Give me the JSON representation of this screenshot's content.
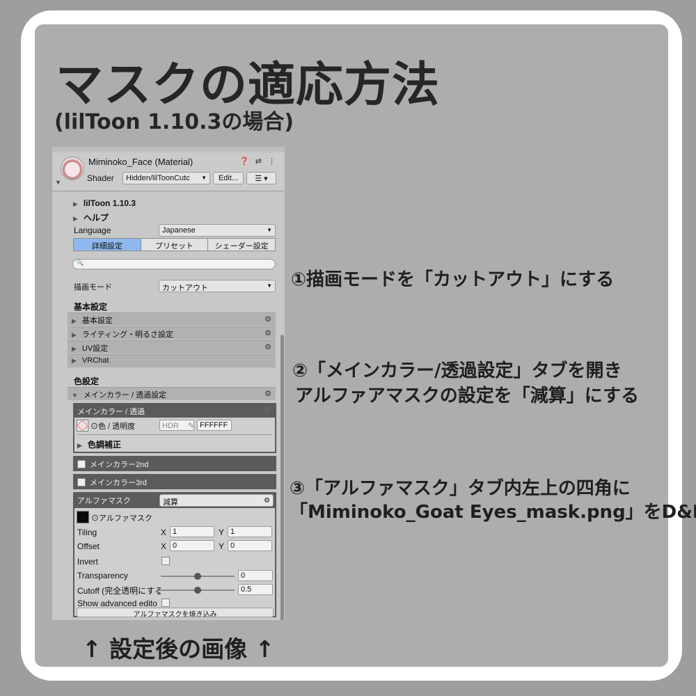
{
  "heading": {
    "title": "マスクの適応方法",
    "subtitle": "(lilToon 1.10.3の場合)"
  },
  "steps": [
    "①描画モードを「カットアウト」にする",
    "②「メインカラー/透過設定」タブを開き",
    "アルファアマスクの設定を「減算」にする",
    "③「アルファマスク」タブ内左上の四角に",
    "「Miminoko_Goat Eyes_mask.png」をD&D"
  ],
  "caption": "↑ 設定後の画像 ↑",
  "inspector": {
    "material_name": "Miminoko_Face (Material)",
    "header_icons": "❓ ⇄ ⋮",
    "shader_label": "Shader",
    "shader_value": "Hidden/lilToonCutc",
    "edit_button": "Edit...",
    "list_button": "☰ ▾",
    "version": "lilToon 1.10.3",
    "help": "ヘルプ",
    "language_label": "Language",
    "language_value": "Japanese",
    "tabs": [
      "詳細設定",
      "プリセット",
      "シェーダー設定"
    ],
    "search_icon": "🔍",
    "render_mode_label": "描画モード",
    "render_mode_value": "カットアウト",
    "basic_section": "基本設定",
    "basic_items": [
      "基本設定",
      "ライティング・明るさ設定",
      "UV設定",
      "VRChat"
    ],
    "color_section": "色設定",
    "main_color_header": "メインカラー / 透過設定",
    "main_color_box": {
      "title": "メインカラー / 透過",
      "color_label": "⊙色 / 透明度",
      "hdr": "HDR",
      "hex": "FFFFFF",
      "tone": "色調補正"
    },
    "main_color_2nd": "メインカラー2nd",
    "main_color_3rd": "メインカラー3rd",
    "alpha_mask": {
      "title": "アルファマスク",
      "mode": "減算",
      "texture_label": "⊙アルファマスク",
      "tiling_label": "Tiling",
      "tiling_x": "1",
      "tiling_y": "1",
      "offset_label": "Offset",
      "offset_x": "0",
      "offset_y": "0",
      "x": "X",
      "y": "Y",
      "invert_label": "Invert",
      "transparency_label": "Transparency",
      "transparency_value": "0",
      "cutoff_label": "Cutoff (完全透明にする",
      "cutoff_value": "0.5",
      "advanced_label": "Show advanced edito",
      "bake_button": "アルファマスクを焼き込み"
    }
  }
}
